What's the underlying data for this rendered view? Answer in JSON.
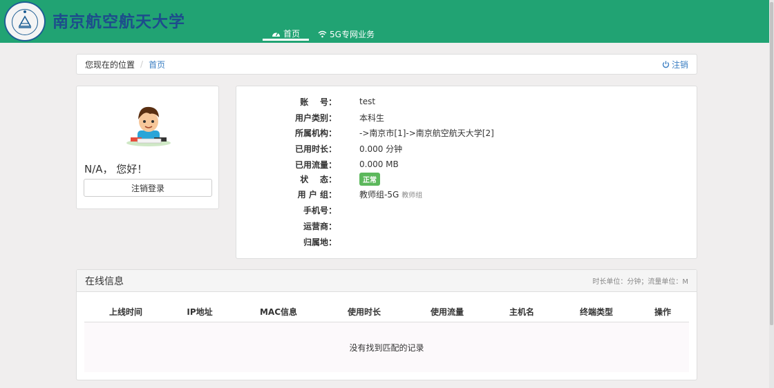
{
  "brand": {
    "name": "南京航空航天大学",
    "seal_color": "#1d5e94",
    "header_color": "#21a373"
  },
  "nav": [
    {
      "label": "首页",
      "icon": "dashboard-icon",
      "active": true
    },
    {
      "label": "5G专网业务",
      "icon": "wifi-icon",
      "active": false
    }
  ],
  "breadcrumb": {
    "prefix": "您现在的位置",
    "separator": "/",
    "current": "首页",
    "logout_label": "注销",
    "logout_icon": "power-icon"
  },
  "profile": {
    "greeting": "N/A，  您好！",
    "logout_button": "注销登录",
    "avatar_icon": "user-avatar-icon"
  },
  "info": {
    "rows": [
      {
        "key": "账    号：",
        "value": "test"
      },
      {
        "key": "用户类别：",
        "value": "本科生"
      },
      {
        "key": "所属机构：",
        "value": "->南京市[1]->南京航空航天大学[2]"
      },
      {
        "key": "已用时长：",
        "value": "0.000 分钟"
      },
      {
        "key": "已用流量：",
        "value": "0.000 MB"
      },
      {
        "key": "状    态：",
        "value": "正常"
      },
      {
        "key": "用 户 组：",
        "value": "教师组-5G",
        "sub": "教师组"
      },
      {
        "key": "手机号：",
        "value": ""
      },
      {
        "key": "运营商：",
        "value": ""
      },
      {
        "key": "归属地：",
        "value": ""
      }
    ],
    "status_color": "#5cb85c"
  },
  "online": {
    "title": "在线信息",
    "units": "时长单位：分钟；流量单位：M",
    "columns": [
      "上线时间",
      "IP地址",
      "MAC信息",
      "使用时长",
      "使用流量",
      "主机名",
      "终端类型",
      "操作"
    ],
    "empty_text": "没有找到匹配的记录"
  }
}
